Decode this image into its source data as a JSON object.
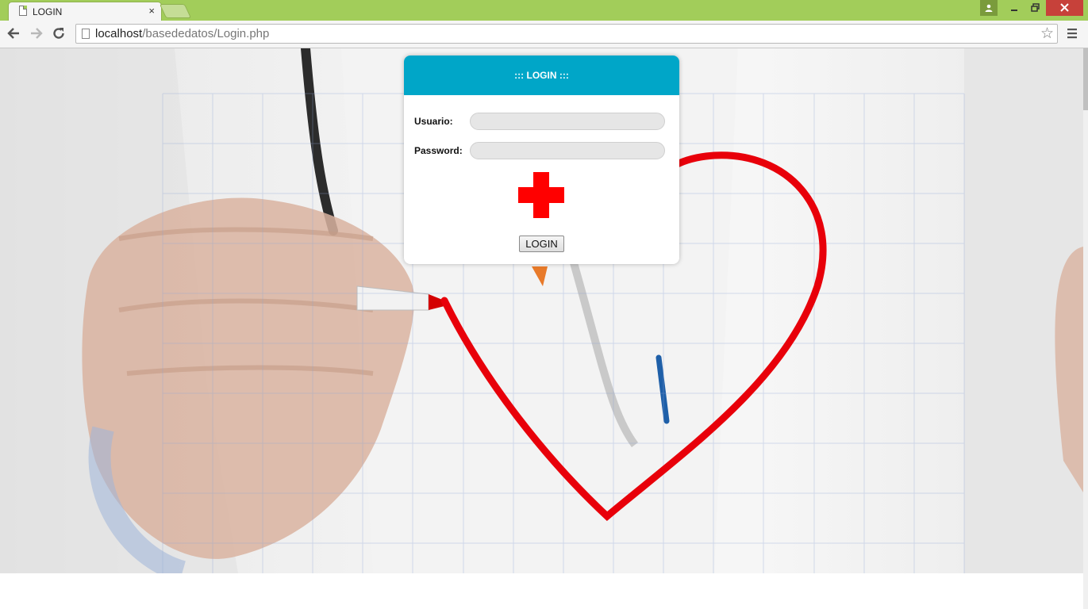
{
  "browser": {
    "tab_title": "LOGIN",
    "tab_close": "×",
    "url_host": "localhost",
    "url_path": "/basededatos/Login.php"
  },
  "icons": {
    "page": "page-icon",
    "back": "back-arrow-icon",
    "forward": "forward-arrow-icon",
    "reload": "reload-icon",
    "bookmark": "star-icon",
    "menu": "hamburger-menu-icon",
    "user": "user-icon",
    "logo": "red-cross-icon"
  },
  "colors": {
    "chrome_frame": "#a2cd5a",
    "login_header": "#00a6c8",
    "cross": "#ff0000",
    "heart": "#e8000a"
  },
  "login": {
    "header": "::: LOGIN :::",
    "user_label": "Usuario:",
    "user_value": "",
    "password_label": "Password:",
    "password_value": "",
    "button_label": "LOGIN"
  }
}
